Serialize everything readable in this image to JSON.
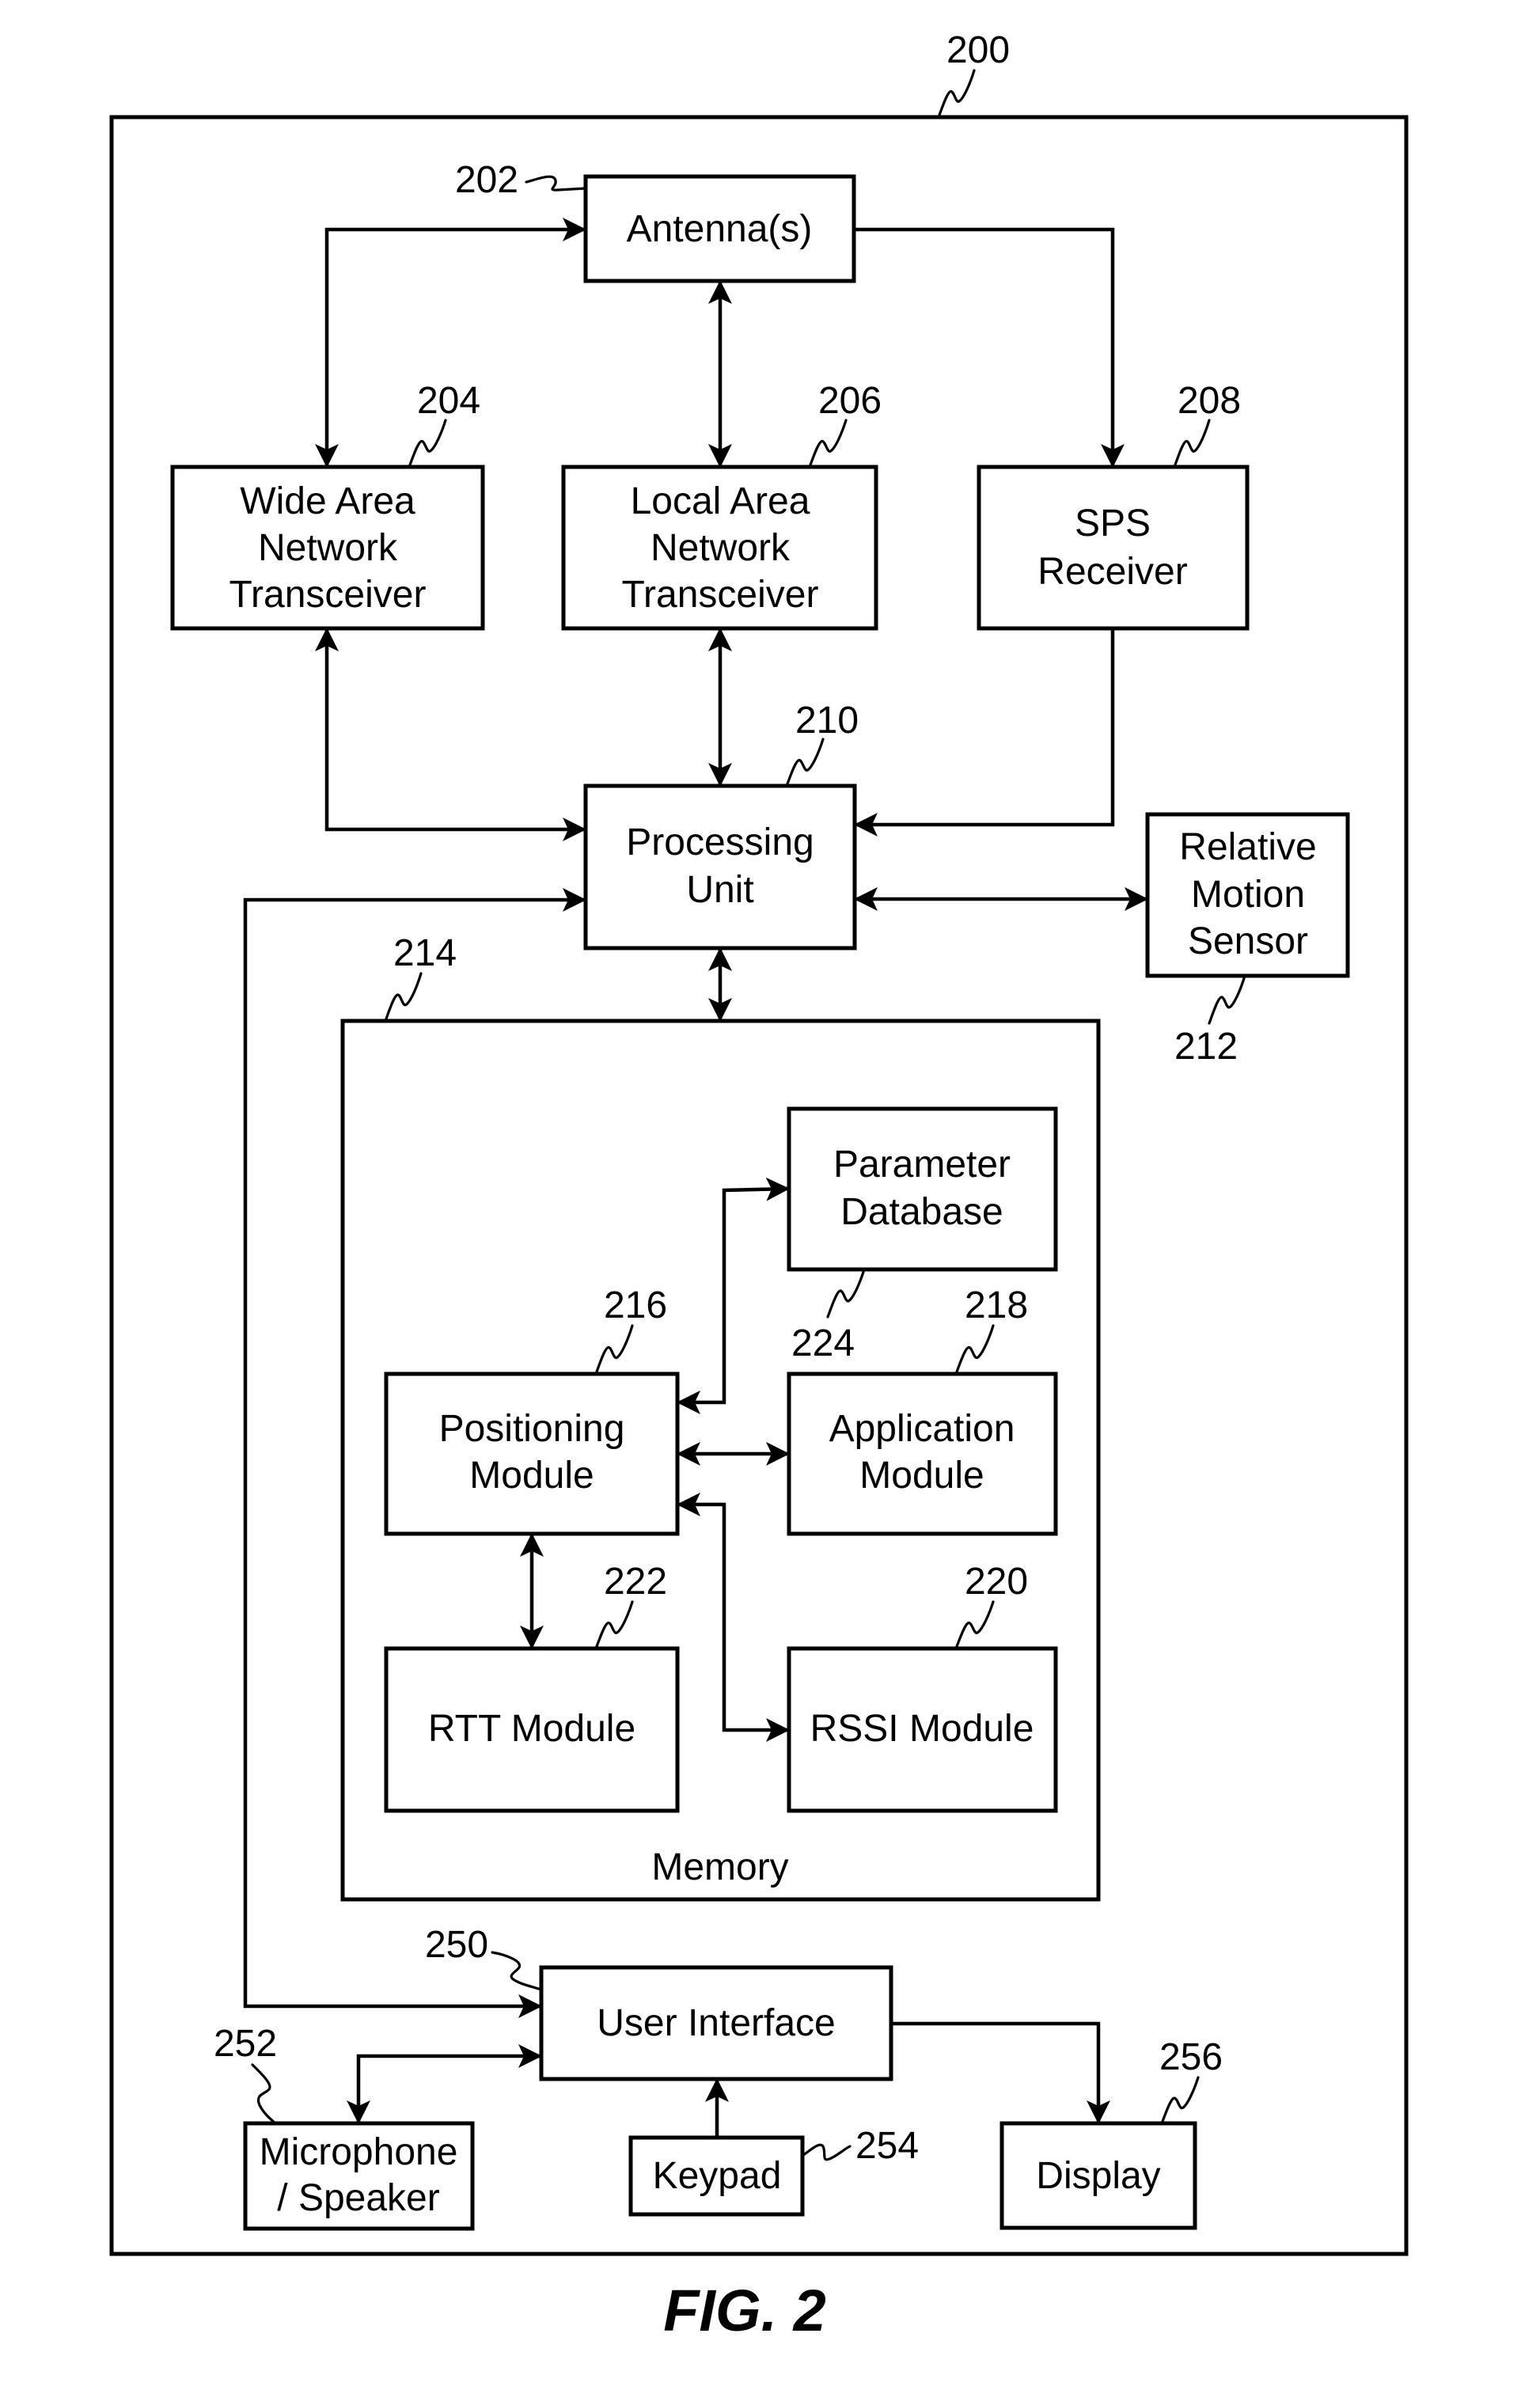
{
  "figure": {
    "caption": "FIG. 2"
  },
  "device": {
    "ref": "200"
  },
  "blocks": {
    "antenna": {
      "ref": "202",
      "lines": [
        "Antenna(s)"
      ]
    },
    "wan": {
      "ref": "204",
      "lines": [
        "Wide Area",
        "Network",
        "Transceiver"
      ]
    },
    "lan": {
      "ref": "206",
      "lines": [
        "Local Area",
        "Network",
        "Transceiver"
      ]
    },
    "sps": {
      "ref": "208",
      "lines": [
        "SPS",
        "Receiver"
      ]
    },
    "processing": {
      "ref": "210",
      "lines": [
        "Processing",
        "Unit"
      ]
    },
    "motion_sensor": {
      "ref": "212",
      "lines": [
        "Relative",
        "Motion",
        "Sensor"
      ]
    },
    "memory": {
      "ref": "214",
      "lines": [
        "Memory"
      ]
    },
    "positioning": {
      "ref": "216",
      "lines": [
        "Positioning",
        "Module"
      ]
    },
    "application": {
      "ref": "218",
      "lines": [
        "Application",
        "Module"
      ]
    },
    "rssi": {
      "ref": "220",
      "lines": [
        "RSSI Module"
      ]
    },
    "rtt": {
      "ref": "222",
      "lines": [
        "RTT Module"
      ]
    },
    "parameter_db": {
      "ref": "224",
      "lines": [
        "Parameter",
        "Database"
      ]
    },
    "user_interface": {
      "ref": "250",
      "lines": [
        "User Interface"
      ]
    },
    "mic_speaker": {
      "ref": "252",
      "lines": [
        "Microphone",
        "/ Speaker"
      ]
    },
    "keypad": {
      "ref": "254",
      "lines": [
        "Keypad"
      ]
    },
    "display": {
      "ref": "256",
      "lines": [
        "Display"
      ]
    }
  },
  "connections": [
    {
      "from": "antenna",
      "to": "wan",
      "direction": "bidirectional"
    },
    {
      "from": "antenna",
      "to": "lan",
      "direction": "bidirectional"
    },
    {
      "from": "antenna",
      "to": "sps",
      "direction": "forward"
    },
    {
      "from": "wan",
      "to": "processing",
      "direction": "bidirectional"
    },
    {
      "from": "lan",
      "to": "processing",
      "direction": "bidirectional"
    },
    {
      "from": "sps",
      "to": "processing",
      "direction": "forward"
    },
    {
      "from": "processing",
      "to": "motion_sensor",
      "direction": "bidirectional"
    },
    {
      "from": "processing",
      "to": "memory",
      "direction": "bidirectional"
    },
    {
      "from": "processing",
      "to": "user_interface",
      "direction": "bidirectional"
    },
    {
      "from": "positioning",
      "to": "parameter_db",
      "direction": "bidirectional"
    },
    {
      "from": "positioning",
      "to": "application",
      "direction": "bidirectional"
    },
    {
      "from": "positioning",
      "to": "rssi",
      "direction": "bidirectional"
    },
    {
      "from": "positioning",
      "to": "rtt",
      "direction": "bidirectional"
    },
    {
      "from": "user_interface",
      "to": "mic_speaker",
      "direction": "bidirectional"
    },
    {
      "from": "keypad",
      "to": "user_interface",
      "direction": "forward"
    },
    {
      "from": "user_interface",
      "to": "display",
      "direction": "forward"
    }
  ]
}
